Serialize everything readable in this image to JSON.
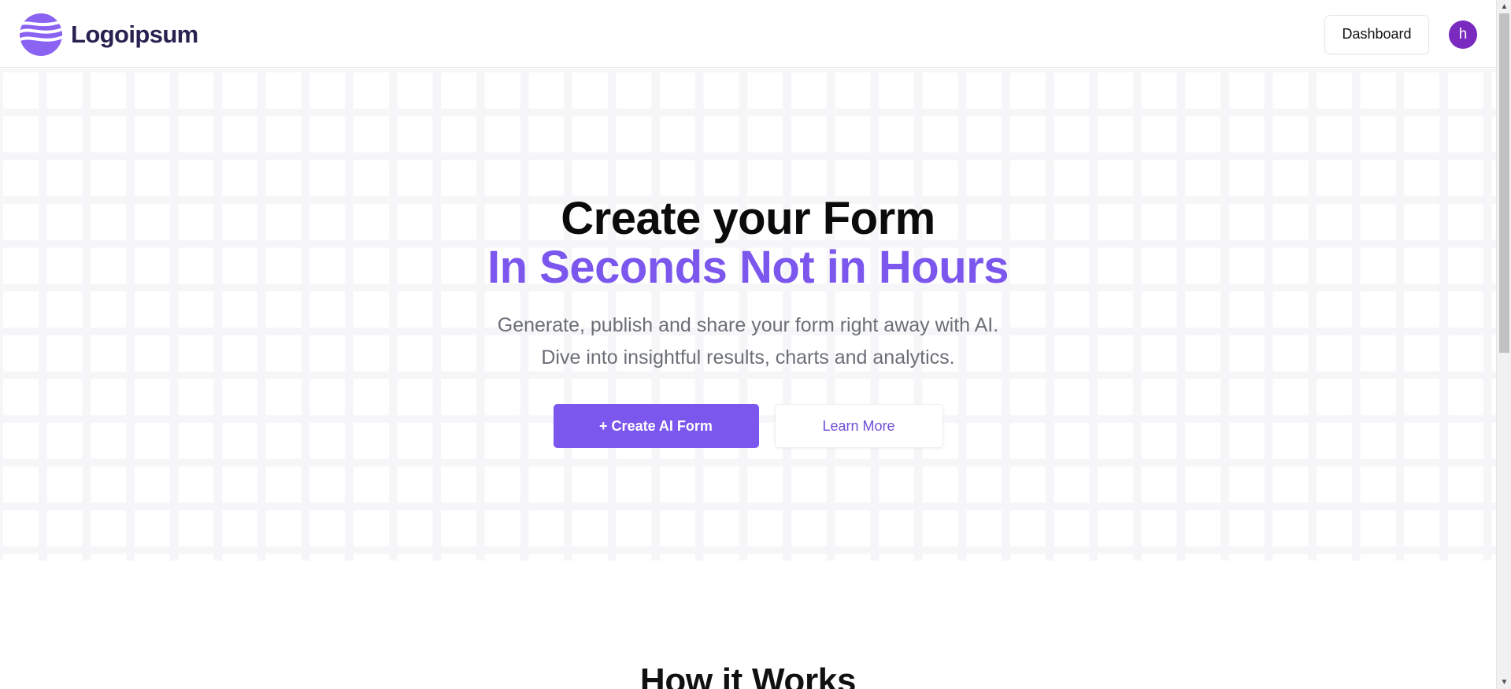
{
  "header": {
    "brand_name": "Logoipsum",
    "dashboard_label": "Dashboard",
    "avatar_initial": "h"
  },
  "hero": {
    "title": "Create your Form",
    "subtitle": "In Seconds Not in Hours",
    "description_line1": "Generate, publish and share your form right away with AI.",
    "description_line2": "Dive into insightful results, charts and analytics.",
    "create_button_label": "+ Create AI Form",
    "learn_button_label": "Learn More"
  },
  "section": {
    "how_title": "How it Works"
  },
  "colors": {
    "accent": "#7c57ee",
    "avatar": "#7b2abf",
    "brand_text": "#2a2150"
  },
  "icons": {
    "logo": "wave-logo-icon",
    "scroll_up": "scroll-up-arrow-icon",
    "scroll_down": "scroll-down-arrow-icon"
  }
}
